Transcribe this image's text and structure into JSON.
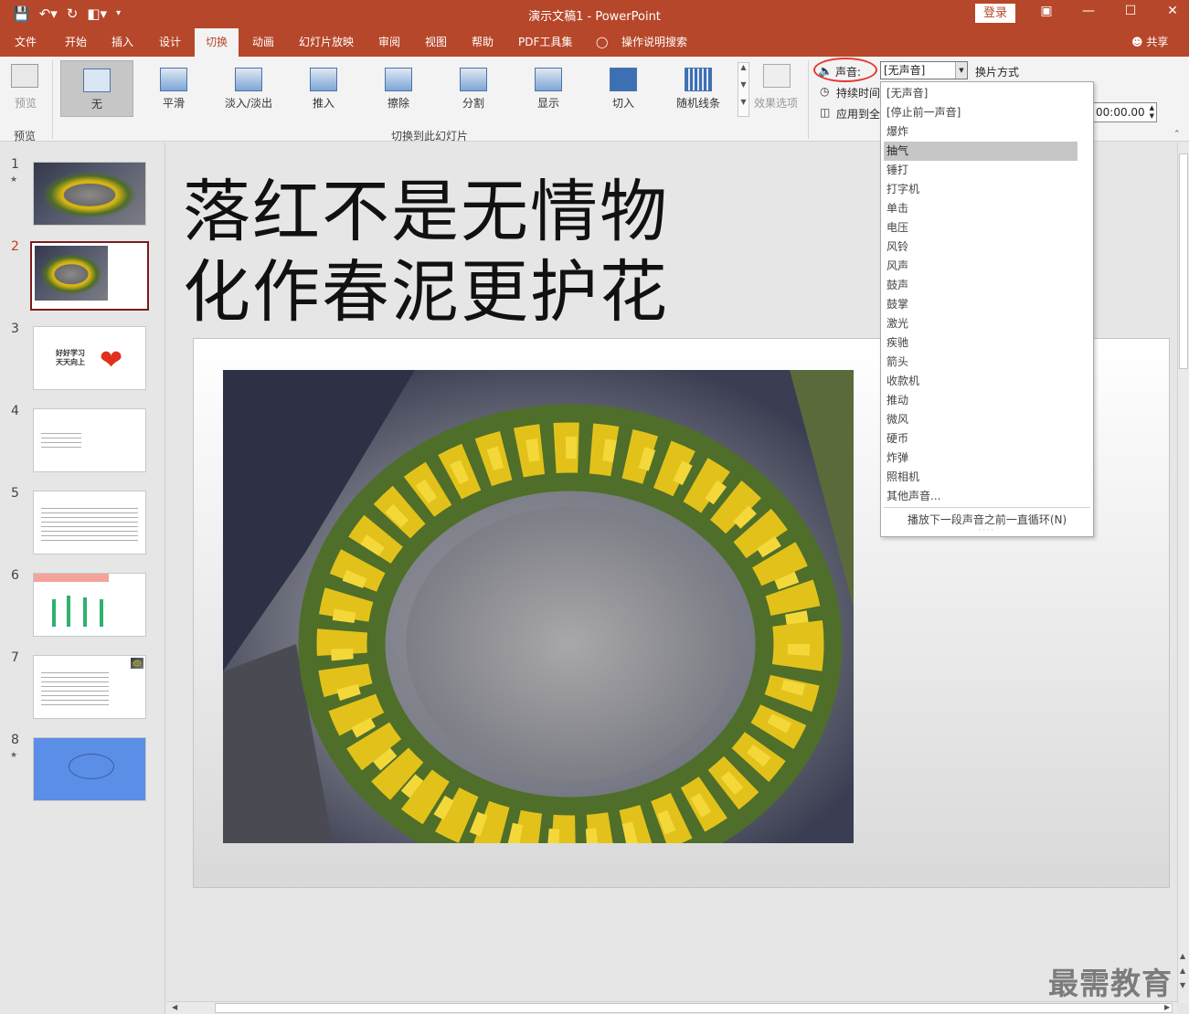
{
  "window": {
    "title": "演示文稿1  -  PowerPoint",
    "login_label": "登录",
    "share_label": "共享",
    "qat_icons": [
      "save-icon",
      "undo-icon",
      "redo-icon",
      "present-from-start-icon",
      "customize-qat-icon"
    ],
    "controls": [
      "ribbon-display-icon",
      "minimize-icon",
      "maximize-icon",
      "close-icon"
    ],
    "brand_color": "#b7472a"
  },
  "tabs": [
    {
      "label": "文件"
    },
    {
      "label": "开始"
    },
    {
      "label": "插入"
    },
    {
      "label": "设计"
    },
    {
      "label": "切换",
      "active": true
    },
    {
      "label": "动画"
    },
    {
      "label": "幻灯片放映"
    },
    {
      "label": "审阅"
    },
    {
      "label": "视图"
    },
    {
      "label": "帮助"
    },
    {
      "label": "PDF工具集"
    },
    {
      "label": "操作说明搜索"
    }
  ],
  "ribbon": {
    "preview_button": "预览",
    "preview_group": "预览",
    "transitions_group": "切换到此幻灯片",
    "transitions": [
      {
        "label": "无",
        "selected": true
      },
      {
        "label": "平滑"
      },
      {
        "label": "淡入/淡出"
      },
      {
        "label": "推入"
      },
      {
        "label": "擦除"
      },
      {
        "label": "分割"
      },
      {
        "label": "显示"
      },
      {
        "label": "切入"
      },
      {
        "label": "随机线条"
      }
    ],
    "effect_options": "效果选项",
    "sound_label": "声音:",
    "sound_value": "[无声音]",
    "advance_label": "换片方式",
    "duration_label": "持续时间",
    "apply_all_label": "应用到全",
    "time_value": "00:00.00"
  },
  "sound_dropdown": {
    "items": [
      "[无声音]",
      "[停止前一声音]",
      "爆炸",
      "抽气",
      "锤打",
      "打字机",
      "单击",
      "电压",
      "风铃",
      "风声",
      "鼓声",
      "鼓掌",
      "激光",
      "疾驰",
      "箭头",
      "收款机",
      "推动",
      "微风",
      "硬币",
      "炸弹",
      "照相机",
      "其他声音..."
    ],
    "highlighted_index": 3,
    "loop_option": "播放下一段声音之前一直循环(N)"
  },
  "slides": [
    {
      "number": "1",
      "star": true
    },
    {
      "number": "2",
      "active": true
    },
    {
      "number": "3",
      "text": "好好学习\n天天向上"
    },
    {
      "number": "4"
    },
    {
      "number": "5"
    },
    {
      "number": "6"
    },
    {
      "number": "7"
    },
    {
      "number": "8",
      "star": true
    }
  ],
  "slide": {
    "title_line1": "落红不是无情物",
    "title_line2": "化作春泥更护花"
  },
  "watermark": "最需教育"
}
